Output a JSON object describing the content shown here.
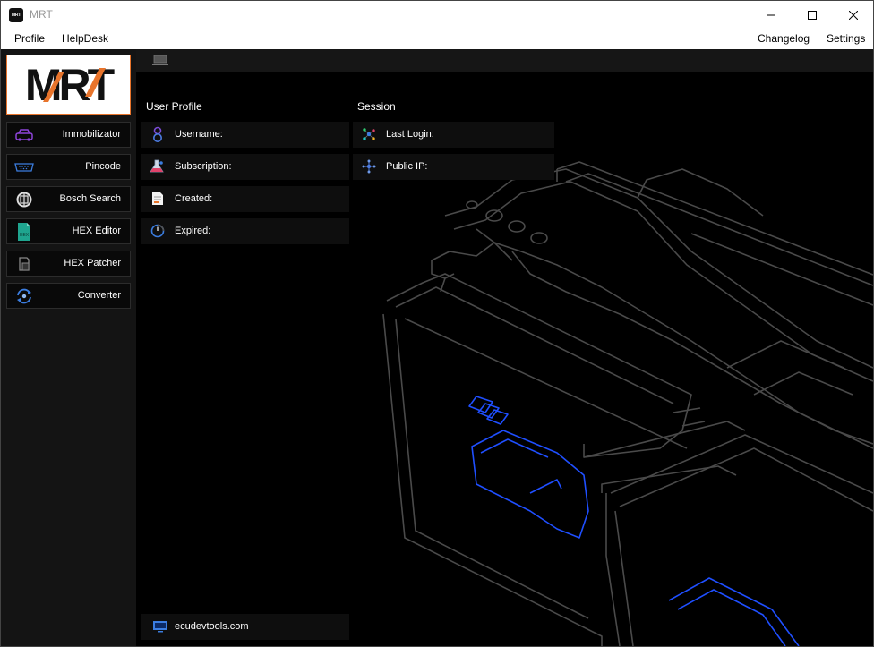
{
  "window": {
    "title": "MRT",
    "app_icon_text": "MRT"
  },
  "menu": {
    "left": [
      "Profile",
      "HelpDesk"
    ],
    "right": [
      "Changelog",
      "Settings"
    ]
  },
  "logo": {
    "text": "MRT",
    "accent": "#e8742b"
  },
  "sidebar": {
    "items": [
      {
        "label": "Immobilizator",
        "icon": "car-icon"
      },
      {
        "label": "Pincode",
        "icon": "serial-port-icon"
      },
      {
        "label": "Bosch Search",
        "icon": "bosch-icon"
      },
      {
        "label": "HEX Editor",
        "icon": "hex-file-icon"
      },
      {
        "label": "HEX Patcher",
        "icon": "patch-icon"
      },
      {
        "label": "Converter",
        "icon": "converter-icon"
      }
    ]
  },
  "profile": {
    "title": "User Profile",
    "rows": [
      {
        "label": "Username:",
        "icon": "user-icon"
      },
      {
        "label": "Subscription:",
        "icon": "flask-icon"
      },
      {
        "label": "Created:",
        "icon": "document-icon"
      },
      {
        "label": "Expired:",
        "icon": "timer-icon"
      }
    ]
  },
  "session": {
    "title": "Session",
    "rows": [
      {
        "label": "Last Login:",
        "icon": "network-icon"
      },
      {
        "label": "Public IP:",
        "icon": "ip-network-icon"
      }
    ]
  },
  "footer": {
    "link": "ecudevtools.com",
    "icon": "monitor-icon"
  },
  "colors": {
    "accent": "#e8742b",
    "highlight_blue": "#1f4fff",
    "line_art": "#4a4a4a"
  }
}
